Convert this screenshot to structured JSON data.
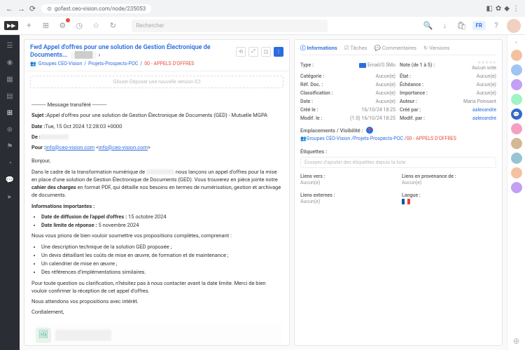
{
  "browser": {
    "url": "gofast.ceo-vision.com/node/235053"
  },
  "toolbar": {
    "search_placeholder": "Rechercher",
    "lang": "FR"
  },
  "doc": {
    "title": "Fwd Appel d'offres pour une solution de Gestion Électronique de Documents...",
    "breadcrumb": {
      "grp": "Groupes CEO-Vision",
      "p1": "Projets-Prospects-POC",
      "p2": "00 - APPELS D'OFFRES"
    },
    "dropzone": "Glisser-Déposer une nouvelle version ICI",
    "fwd_header": "---------- Message transféré ----------",
    "subject_label": "Sujet :",
    "subject": "Appel d'offres pour une solution de Gestion Électronique de Documents (GED) - Mutuelle MGPA",
    "date_label": "Date :",
    "date": "Tue, 15 Oct 2024 12:28:03 +0000",
    "from_label": "De :",
    "for_label": "Pour :",
    "for_email1": "info@ceo-vision.com",
    "for_email2": "info@ceo-vision.com",
    "greeting": "Bonjour,",
    "para1a": "Dans le cadre de la transformation numérique de ",
    "para1b": " nous lançons un appel d'offres pour la mise en place d'une solution de Gestion Électronique de Documents (GED). Vous trouverez en pièce jointe notre ",
    "cahier": "cahier des charges",
    "para1c": " en format PDF, qui détaille nos besoins en termes de numérisation, gestion et archivage de documents.",
    "infos_importantes": "Informations importantes :",
    "li1_label": "Date de diffusion de l'appel d'offres :",
    "li1_val": " 15 octobre 2024",
    "li2_label": "Date limite de réponse :",
    "li2_val": " 5 novembre 2024",
    "para2": "Nous vous prions de bien vouloir soumettre vos propositions complètes, comprenant :",
    "bl1": "Une description technique de la solution GED proposée ;",
    "bl2": "Un devis détaillant les coûts de mise en œuvre, de formation et de maintenance ;",
    "bl3": "Un calendrier de mise en œuvre ;",
    "bl4": "Des références d'implémentations similaires.",
    "para3": "Pour toute question ou clarification, n'hésitez pas à nous contacter avant la date limite. Merci de bien vouloir confirmer la réception de cet appel d'offres.",
    "para4": "Nous attendons vos propositions avec intérêt.",
    "closing": "Cordialement,"
  },
  "tabs": {
    "info": "Informations",
    "tasks": "Tâches",
    "comments": "Commentaires",
    "versions": "Versions"
  },
  "meta": {
    "type_l": "Type :",
    "type_v": "Email/0.5Mo",
    "note_l": "Note (de 1 à 5) :",
    "note_v": "Aucun vote",
    "cat_l": "Catégorie :",
    "cat_v": "Aucun(e)",
    "etat_l": "État :",
    "etat_v": "Aucun(e)",
    "ref_l": "Réf. Doc. :",
    "ref_v": "Aucun(e)",
    "ech_l": "Échéance :",
    "ech_v": "Aucun(e)",
    "class_l": "Classification :",
    "class_v": "Aucun(e)",
    "imp_l": "Importance :",
    "imp_v": "Aucun(e)",
    "date_l": "Date :",
    "date_v": "Aucun(e)",
    "auteur_l": "Auteur :",
    "auteur_v": "Maria Poinsant",
    "cree_l": "Créé le :",
    "cree_v": "16/10/24 18:25",
    "creepar_l": "Créé par :",
    "creepar_v": "aalexandre",
    "modif_l": "Modif. le :",
    "modif_v": "(1.0) 16/10/24 18:25",
    "modifpar_l": "Modif. par :",
    "modifpar_v": "aalexandre"
  },
  "loc": {
    "title": "Emplacements / Visibilité :",
    "grp": "Groupes CEO-Vision",
    "p1": "Projets-Prospects-POC",
    "p2": "00 - APPELS D'OFFRES"
  },
  "tags": {
    "title": "Étiquettes :",
    "placeholder": "Essayez d'ajouter des étiquettes depuis la liste"
  },
  "links": {
    "vers_l": "Liens vers :",
    "vers_v": "Aucun(e)",
    "prov_l": "Liens en provenance de :",
    "prov_v": "Aucun(e)",
    "ext_l": "Liens externes :",
    "ext_v": "Aucun(e)",
    "lang_l": "Langue :"
  }
}
